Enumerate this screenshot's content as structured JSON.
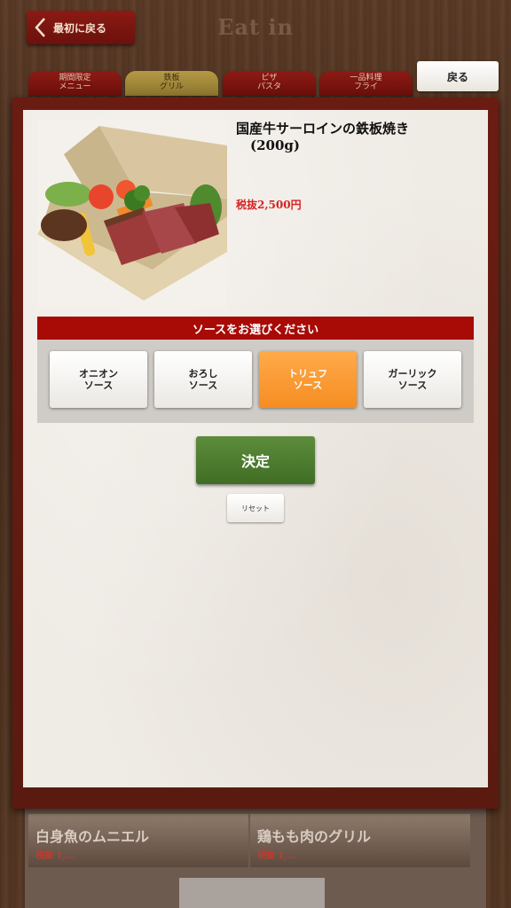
{
  "header": {
    "back_label": "最初に戻る",
    "title": "Eat in"
  },
  "tabs": [
    {
      "line1": "期間限定",
      "line2": "メニュー",
      "active": false
    },
    {
      "line1": "鉄板",
      "line2": "グリル",
      "active": true
    },
    {
      "line1": "ピザ",
      "line2": "パスタ",
      "active": false
    },
    {
      "line1": "一品料理",
      "line2": "フライ",
      "active": false
    }
  ],
  "tab_back_label": "戻る",
  "background_items": [
    {
      "name": "白身魚のムニエル",
      "price": "税抜 1,..."
    },
    {
      "name": "鶏もも肉のグリル",
      "price": "税抜 1,..."
    }
  ],
  "product": {
    "name": "国産牛サーロインの鉄板焼き",
    "weight": "(200g)",
    "price": "税抜2,500円",
    "image_icon": "steak-bento-photo"
  },
  "sauce": {
    "header": "ソースをお選びください",
    "options": [
      {
        "line1": "オニオン",
        "line2": "ソース",
        "selected": false
      },
      {
        "line1": "おろし",
        "line2": "ソース",
        "selected": false
      },
      {
        "line1": "トリュフ",
        "line2": "ソース",
        "selected": true
      },
      {
        "line1": "ガーリック",
        "line2": "ソース",
        "selected": false
      }
    ]
  },
  "actions": {
    "confirm_label": "決定",
    "reset_label": "リセット"
  },
  "colors": {
    "brand_red": "#a80a06",
    "selected_orange": "#f68d22",
    "confirm_green": "#4f7d30",
    "price_red": "#d62020"
  }
}
